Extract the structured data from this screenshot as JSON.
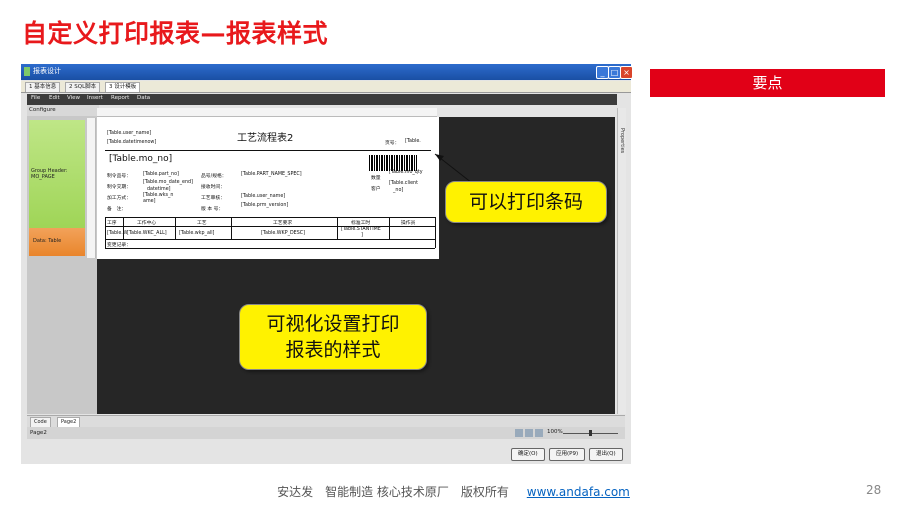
{
  "slide": {
    "title": "自定义打印报表—报表样式",
    "key_points": "要点",
    "footer_text": "安达发　智能制造 核心技术原厂　版权所有",
    "footer_link": "www.andafa.com",
    "page_number": "28"
  },
  "window": {
    "title": "报表设计",
    "tabs": [
      "1 基本信息",
      "2 SQL脚本",
      "3 设计模板"
    ],
    "menu": [
      "File",
      "Edit",
      "View",
      "Insert",
      "Report",
      "Data"
    ],
    "configure_label": "Configure",
    "group_header_label": "Group Header: MO_PAGE",
    "data_band_label": "Data: Table",
    "right_strip_label": "Properties",
    "bottom_tabs": [
      "Code",
      "Page2"
    ],
    "status_text": "Page2",
    "zoom": "100%",
    "buttons": {
      "ok": "确定(O)",
      "apply": "应用(P9)",
      "exit": "退出(Q)"
    }
  },
  "report": {
    "user_name": "[Table.user_name]",
    "datetime": "[Table.datetimenow]",
    "title": "工艺流程表2",
    "page_label": "页号：",
    "page_value": "[Table.",
    "mo_no": "[Table.mo_no]",
    "labels": {
      "make_product": "制令品号：",
      "make_date": "制令交期：",
      "process_dept": "加工方式：",
      "remark": "备　注：",
      "product_spec": "品号/规格：",
      "receive_time": "接收时间：",
      "process_review": "工艺审核：",
      "version": "版 本 号：",
      "qty": "数量",
      "customer": "客户"
    },
    "values": {
      "part_no": "[Table.part_no]",
      "mo_date": "[Table.mo_date_end]",
      "dt": "datetime]",
      "wks": "[Table.wks_n",
      "ame": "ame]",
      "part_spec": "[Table.PART_NAME_SPEC]",
      "user_name2": "[Table.user_name]",
      "version": "[Table.prm_version]",
      "mo_qty": "[Table.mo_qty",
      "client": "[Table.client",
      "no": "_no]"
    },
    "table_headers": [
      "工序",
      "工作中心",
      "工艺",
      "工艺要求",
      "标准工时",
      "操作员"
    ],
    "row_cells": [
      "[Table.W",
      "[Table.WKC_ALL]",
      "[Table.wkp_all]",
      "[Table.WKP_DESC]",
      "[Table.STANTIME",
      "]"
    ],
    "change_log": "变更记录："
  },
  "callouts": {
    "barcode": "可以打印条码",
    "visual_line1": "可视化设置打印",
    "visual_line2": "报表的样式"
  }
}
